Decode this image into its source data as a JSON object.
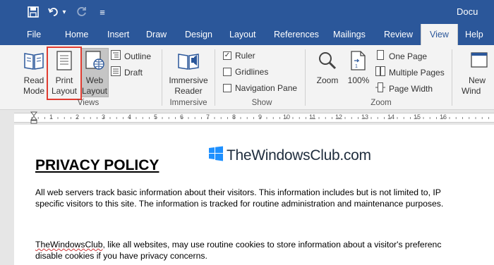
{
  "window": {
    "title": "Docu"
  },
  "qat": {
    "undo_dropdown": "▾",
    "customize": "≡"
  },
  "tabs": [
    {
      "label": "File"
    },
    {
      "label": "Home"
    },
    {
      "label": "Insert"
    },
    {
      "label": "Draw"
    },
    {
      "label": "Design"
    },
    {
      "label": "Layout"
    },
    {
      "label": "References"
    },
    {
      "label": "Mailings"
    },
    {
      "label": "Review"
    },
    {
      "label": "View",
      "active": true
    },
    {
      "label": "Help"
    }
  ],
  "ribbon": {
    "views": {
      "group_label": "Views",
      "read_mode": [
        "Read",
        "Mode"
      ],
      "print_layout": [
        "Print",
        "Layout"
      ],
      "web_layout": [
        "Web",
        "Layout"
      ],
      "outline": "Outline",
      "draft": "Draft"
    },
    "immersive": {
      "group_label": "Immersive",
      "immersive_reader": [
        "Immersive",
        "Reader"
      ]
    },
    "show": {
      "group_label": "Show",
      "ruler": {
        "label": "Ruler",
        "checked": true
      },
      "gridlines": {
        "label": "Gridlines",
        "checked": false
      },
      "navigation_pane": {
        "label": "Navigation Pane",
        "checked": false
      }
    },
    "zoom": {
      "group_label": "Zoom",
      "zoom": "Zoom",
      "hundred": "100%",
      "one_page": "One Page",
      "multiple_pages": "Multiple Pages",
      "page_width": "Page Width"
    },
    "window": {
      "new_window": [
        "New",
        "Wind"
      ]
    }
  },
  "ruler": {
    "numbers": [
      "1",
      "2",
      "3",
      "4",
      "5",
      "6",
      "7",
      "8",
      "9",
      "10",
      "11",
      "12",
      "13",
      "14",
      "15",
      "16"
    ]
  },
  "document": {
    "logo_text": "TheWindowsClub.com",
    "heading": "PRIVACY POLICY",
    "para1_line1": "All web servers track basic information about their visitors. This information includes but is not limited to, IP",
    "para1_line2": "specific visitors to this site. The information is tracked for routine administration and maintenance purposes.",
    "para2_word": "TheWindowsClub",
    "para2_line1_rest": ", like all websites, may use routine cookies to store information about a visitor's preferenc",
    "para2_line2": "disable cookies if you have privacy concerns."
  },
  "colors": {
    "accent": "#2b579a",
    "highlight": "#e03c31",
    "logo": "#1e90ff"
  }
}
